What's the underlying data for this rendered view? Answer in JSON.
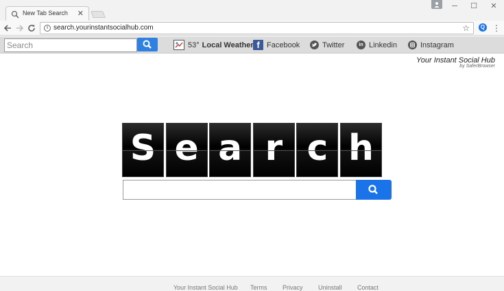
{
  "browser": {
    "tab_title": "New Tab Search",
    "tab_close": "✕",
    "url": "search.yourinstantsocialhub.com",
    "window_controls": {
      "minimize": "─",
      "maximize": "☐",
      "close": "✕"
    }
  },
  "extbar": {
    "search_placeholder": "Search",
    "weather_temp": "53°",
    "weather_label": "Local Weather",
    "links": {
      "facebook": "Facebook",
      "twitter": "Twitter",
      "linkedin": "Linkedin",
      "instagram": "Instagram"
    }
  },
  "brand": {
    "title": "Your Instant Social Hub",
    "subtitle": "by SaferBrowser"
  },
  "logo_letters": [
    "S",
    "e",
    "a",
    "r",
    "c",
    "h"
  ],
  "footer": {
    "links": [
      "Your Instant Social Hub",
      "Terms",
      "Privacy",
      "Uninstall",
      "Contact"
    ]
  },
  "colors": {
    "accent": "#1a73e8",
    "ext_search_button": "#2f80e0",
    "facebook": "#3b5998"
  }
}
